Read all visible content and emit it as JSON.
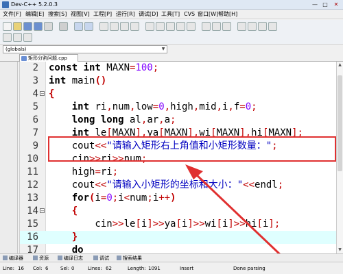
{
  "window": {
    "title": "Dev-C++ 5.2.0.3",
    "minimize": "—",
    "maximize": "□",
    "close": "✕"
  },
  "menu": [
    "文件[F]",
    "编辑[E]",
    "搜索[S]",
    "视图[V]",
    "工程[P]",
    "运行[R]",
    "调试[D]",
    "工具[T]",
    "CVS",
    "窗口[W]",
    "帮助[H]"
  ],
  "scope": {
    "value": "(globals)"
  },
  "tab": {
    "label": "矩形分割问题.cpp"
  },
  "editor": {
    "lines": [
      {
        "n": "2",
        "code": "const int MAXN=100;"
      },
      {
        "n": "3",
        "code": "int main()"
      },
      {
        "n": "4",
        "code": "{"
      },
      {
        "n": "5",
        "code": "    int ri,num,low=0,high,mid,i,f=0;"
      },
      {
        "n": "6",
        "code": "    long long al,ar,a;"
      },
      {
        "n": "7",
        "code": "    int le[MAXN],ya[MAXN],wi[MAXN],hi[MAXN];"
      },
      {
        "n": "9",
        "code": "    cout<<\"请输入矩形右上角值和小矩形数量：\";"
      },
      {
        "n": "10",
        "code": "    cin>>ri>>num;"
      },
      {
        "n": "11",
        "code": "    high=ri;"
      },
      {
        "n": "12",
        "code": "    cout<<\"请输入小矩形的坐标和大小：\"<<endl;"
      },
      {
        "n": "13",
        "code": "    for(i=0;i<num;i++)"
      },
      {
        "n": "14",
        "code": "    {"
      },
      {
        "n": "15",
        "code": "        cin>>le[i]>>ya[i]>>wi[i]>>hi[i];"
      },
      {
        "n": "16",
        "code": "    }"
      },
      {
        "n": "17",
        "code": "    do"
      }
    ]
  },
  "bottom_tabs": [
    "编译器",
    "资源",
    "编译日志",
    "调试",
    "搜索结果"
  ],
  "status": {
    "line_label": "Line:",
    "line_value": "16",
    "col_label": "Col:",
    "col_value": "6",
    "sel_label": "Sel:",
    "sel_value": "0",
    "lines_label": "Lines:",
    "lines_value": "62",
    "length_label": "Length:",
    "length_value": "1091",
    "mode": "Insert",
    "message": "Done parsing"
  },
  "colors": {
    "annotation": "#e03030",
    "highlight_line": "#dfffff",
    "keyword": "#000000",
    "number": "#8000ff",
    "operator": "#c00000",
    "string": "#0000c0"
  },
  "icons": [
    "app-icon",
    "new-file-icon",
    "open-icon",
    "save-icon",
    "save-all-icon",
    "close-icon",
    "print-icon",
    "undo-icon",
    "redo-icon",
    "find-icon",
    "replace-icon",
    "compile-icon",
    "run-icon",
    "compile-run-icon",
    "rebuild-icon",
    "debug-icon",
    "check-icon",
    "chart-icon",
    "new-project-icon",
    "insert-icon",
    "toggle-icon",
    "goto-icon"
  ]
}
